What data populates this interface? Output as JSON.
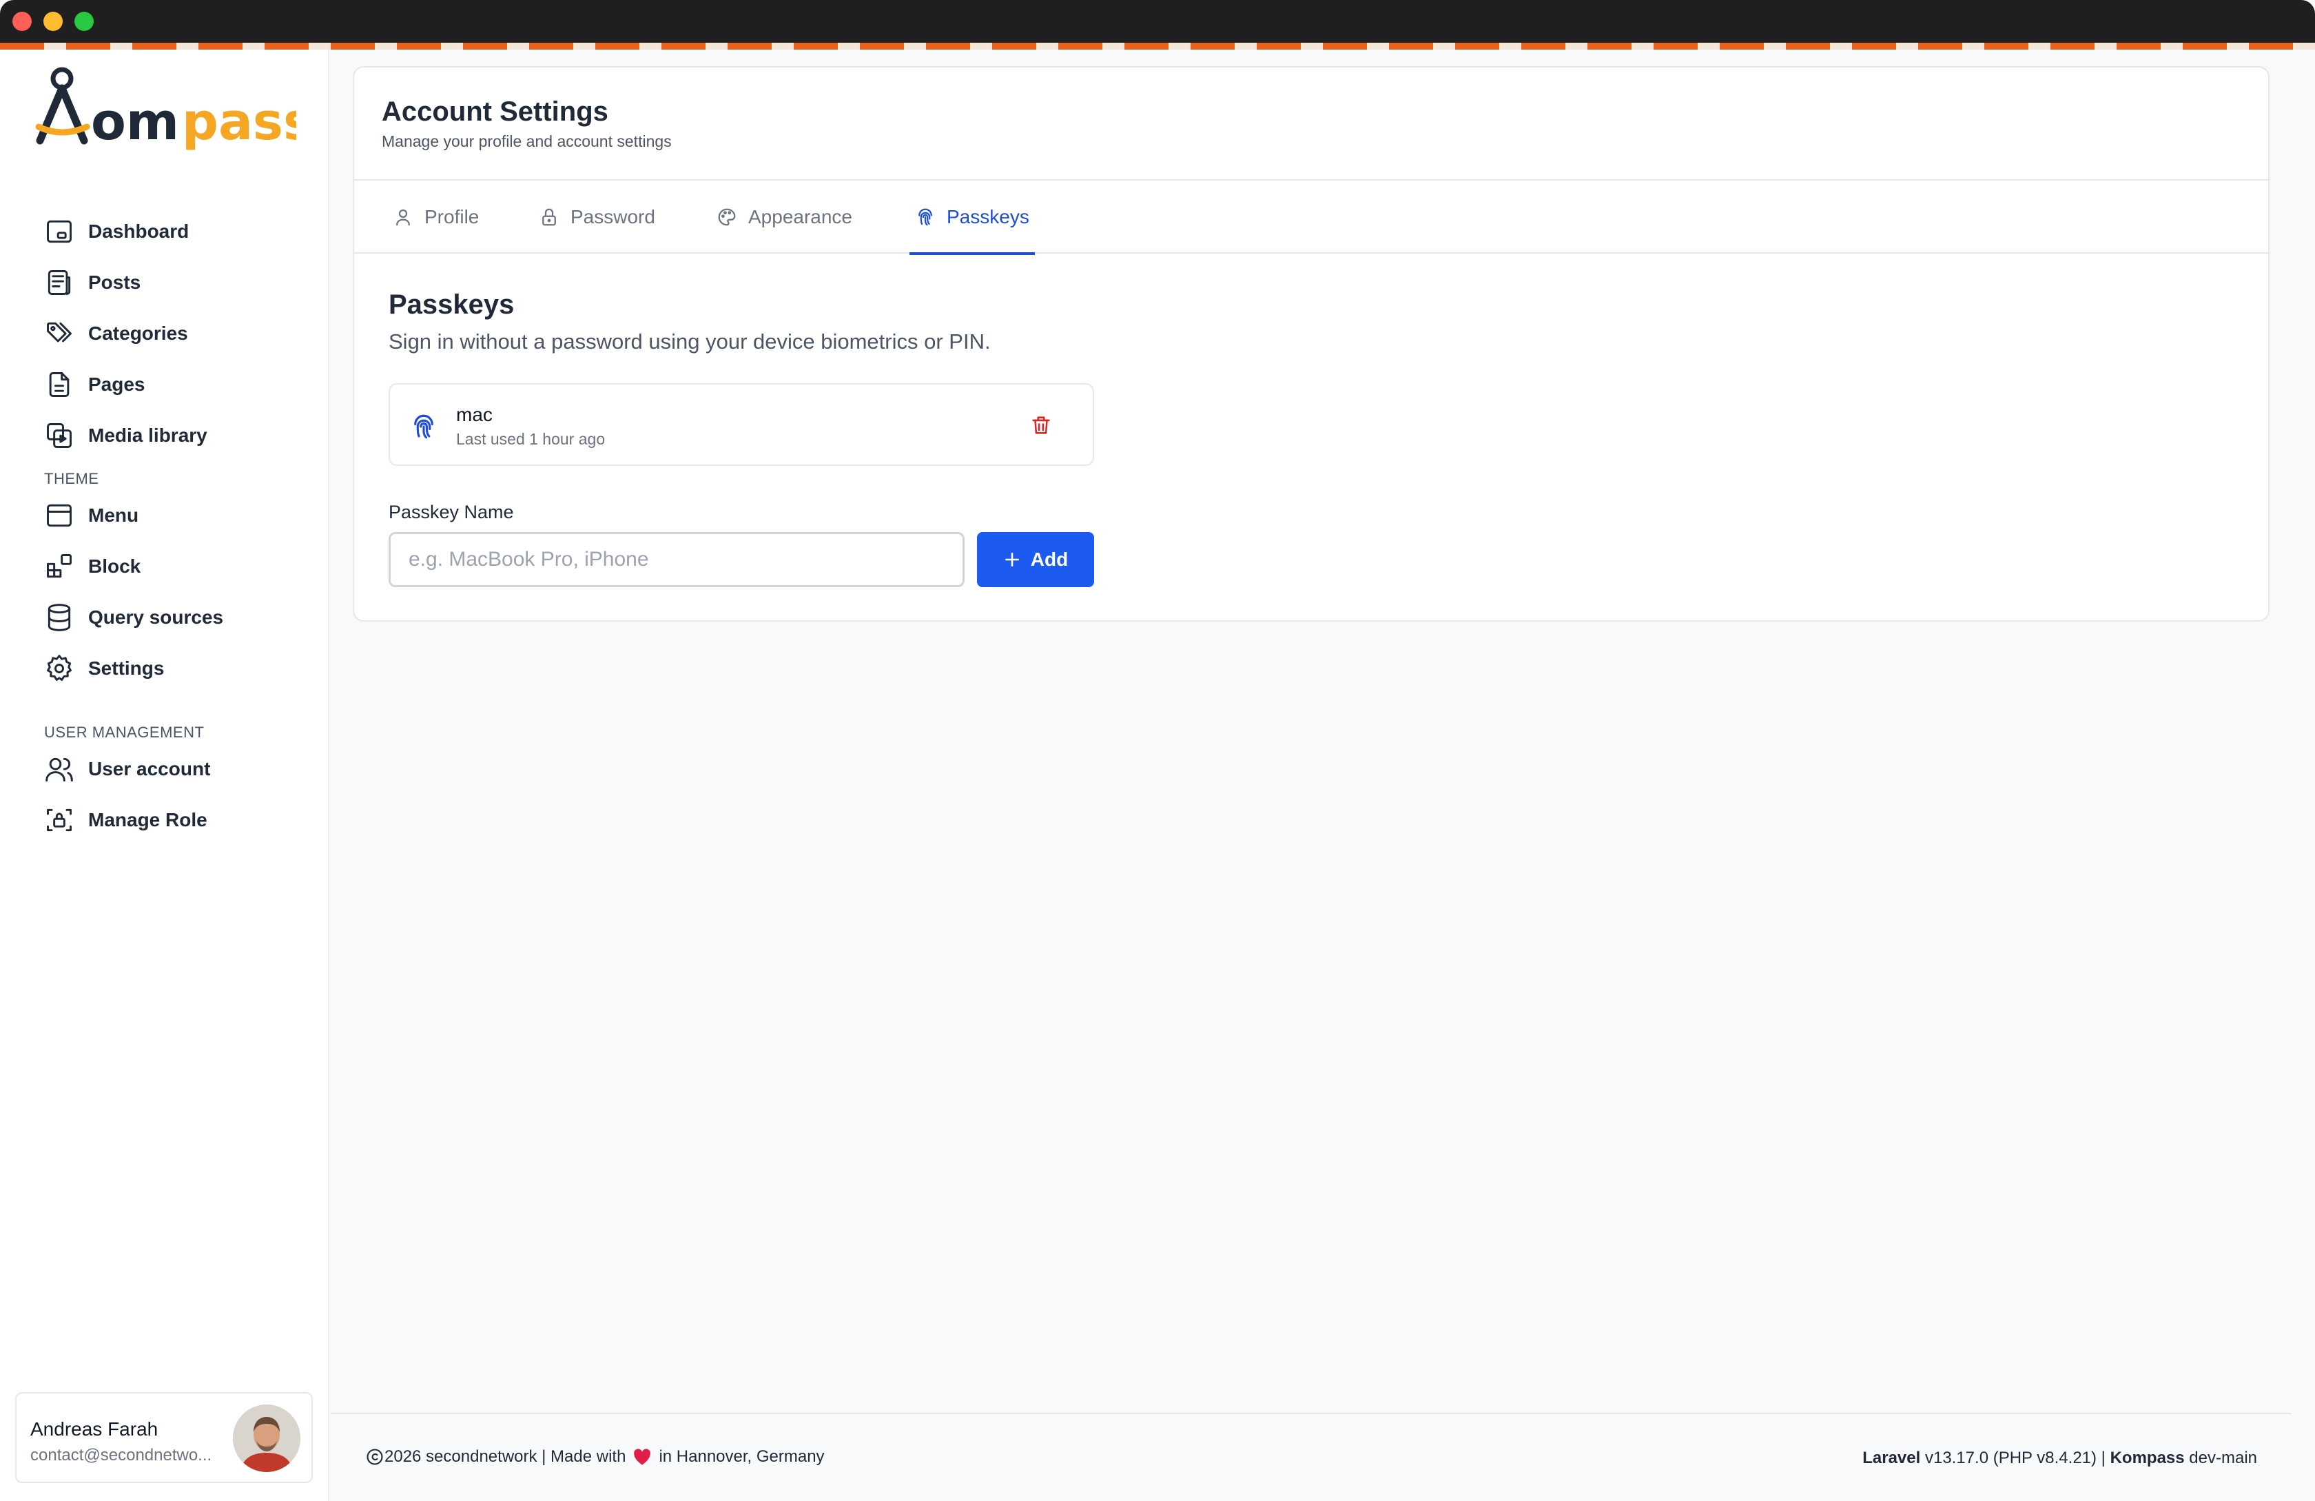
{
  "app": {
    "name": "Kompass",
    "brand_colors": {
      "primary": "#1d5bf0",
      "accent": "#f5a623",
      "stripe": "#e8611a",
      "danger": "#dc2626"
    }
  },
  "sidebar": {
    "nav": [
      {
        "label": "Dashboard",
        "icon": "dashboard-icon"
      },
      {
        "label": "Posts",
        "icon": "posts-icon"
      },
      {
        "label": "Categories",
        "icon": "tag-icon"
      },
      {
        "label": "Pages",
        "icon": "page-icon"
      },
      {
        "label": "Media library",
        "icon": "media-icon"
      }
    ],
    "theme_heading": "THEME",
    "theme": [
      {
        "label": "Menu",
        "icon": "menu-icon"
      },
      {
        "label": "Block",
        "icon": "block-icon"
      },
      {
        "label": "Query sources",
        "icon": "database-icon"
      },
      {
        "label": "Settings",
        "icon": "gear-icon"
      }
    ],
    "users_heading": "USER MANAGEMENT",
    "users": [
      {
        "label": "User account",
        "icon": "users-icon"
      },
      {
        "label": "Manage Role",
        "icon": "role-icon"
      }
    ],
    "user": {
      "name": "Andreas Farah",
      "email": "contact@secondnetwo..."
    }
  },
  "header": {
    "title": "Account Settings",
    "subtitle": "Manage your profile and account settings"
  },
  "tabs": [
    {
      "label": "Profile",
      "icon": "user-icon"
    },
    {
      "label": "Password",
      "icon": "lock-icon"
    },
    {
      "label": "Appearance",
      "icon": "palette-icon"
    },
    {
      "label": "Passkeys",
      "icon": "fingerprint-icon",
      "active": true
    }
  ],
  "passkeys": {
    "title": "Passkeys",
    "description": "Sign in without a password using your device biometrics or PIN.",
    "items": [
      {
        "name": "mac",
        "last_used": "Last used 1 hour ago"
      }
    ],
    "field_label": "Passkey Name",
    "input_value": "",
    "input_placeholder": "e.g. MacBook Pro, iPhone",
    "add_label": "Add"
  },
  "footer": {
    "left_before": "2026 secondnetwork | Made with",
    "left_after": "in Hannover, Germany",
    "framework": "Laravel",
    "framework_version": " v13.17.0 (PHP v8.4.21) | ",
    "product": "Kompass",
    "product_version": " dev-main"
  }
}
